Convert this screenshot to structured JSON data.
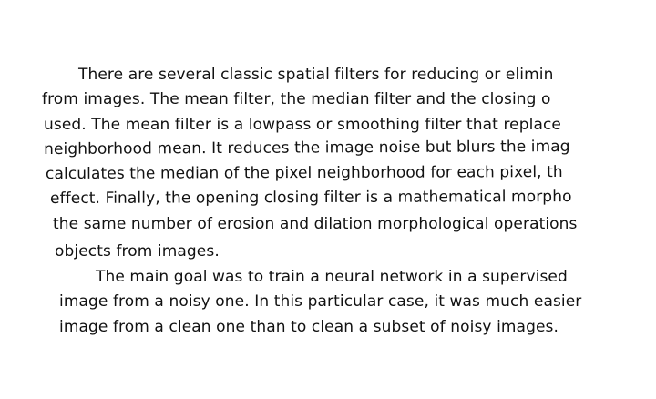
{
  "document": {
    "lines": [
      "There are several classic spatial filters for reducing or elimin",
      "from images. The mean filter, the median filter and the closing o",
      "used. The mean filter is a lowpass or smoothing filter that replace",
      "neighborhood mean. It reduces the image noise but blurs the imag",
      "calculates the median of the pixel neighborhood for each pixel, th",
      "effect. Finally, the opening closing filter is a mathematical morpho",
      "the same number of erosion and dilation morphological operations",
      "objects from images.",
      "The main goal was to train a neural network in a supervised",
      "image from a noisy one. In this particular case, it was much easier",
      "image from a clean one than to clean a subset of noisy images."
    ]
  }
}
